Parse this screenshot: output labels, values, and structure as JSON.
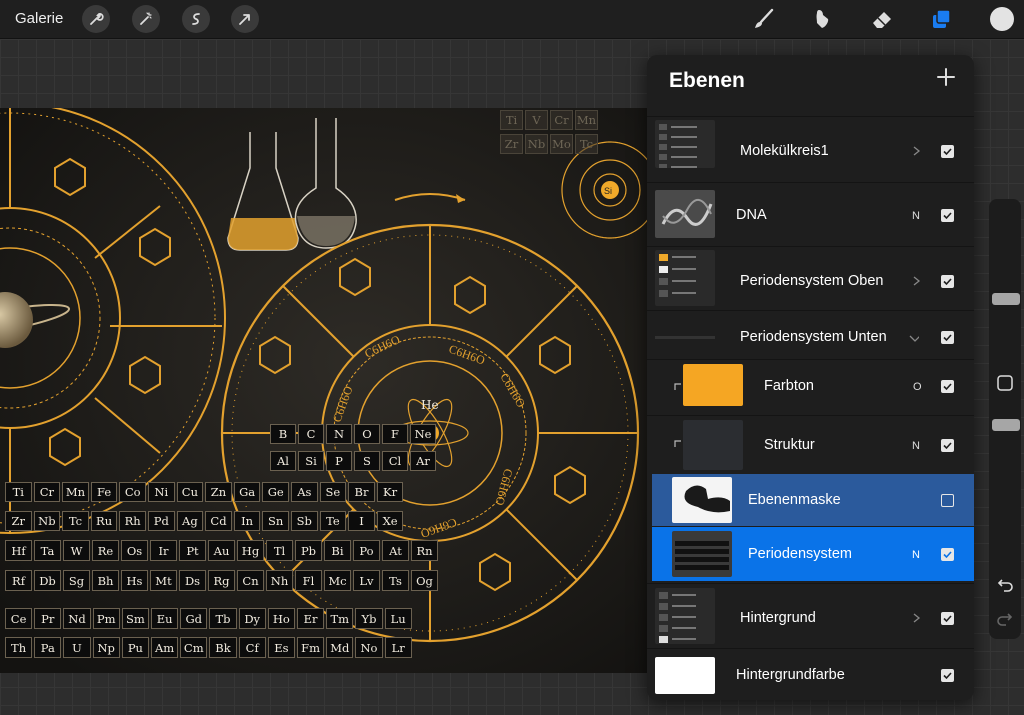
{
  "topbar": {
    "gallery_label": "Galerie",
    "left_tools": [
      "wrench-icon",
      "magic-wand-icon",
      "selection-s-icon",
      "transform-arrow-icon"
    ],
    "right_tools": [
      "brush-icon",
      "smudge-icon",
      "eraser-icon",
      "layers-icon",
      "color-circle-icon"
    ],
    "accent_color": "#1a7cf0",
    "current_color": "#e3e3e3"
  },
  "layers_panel": {
    "title": "Ebenen",
    "add_label": "+",
    "layers": [
      {
        "name": "Molekülkreis1",
        "type": "group",
        "mode": "",
        "visible": true
      },
      {
        "name": "DNA",
        "type": "layer",
        "mode": "N",
        "visible": true
      },
      {
        "name": "Periodensystem Oben",
        "type": "group",
        "mode": "",
        "visible": true
      },
      {
        "name": "Periodensystem Unten",
        "type": "group-expanded",
        "mode": "",
        "visible": true
      },
      {
        "name": "Farbton",
        "type": "clipped",
        "mode": "O",
        "visible": true
      },
      {
        "name": "Struktur",
        "type": "clipped",
        "mode": "N",
        "visible": true
      },
      {
        "name": "Ebenenmaske",
        "type": "mask",
        "mode": "",
        "visible": false
      },
      {
        "name": "Periodensystem",
        "type": "layer-selected",
        "mode": "N",
        "visible": true
      },
      {
        "name": "Hintergrund",
        "type": "group",
        "mode": "",
        "visible": true
      },
      {
        "name": "Hintergrundfarbe",
        "type": "background",
        "mode": "",
        "visible": true
      }
    ]
  },
  "canvas": {
    "periodic_rows": [
      [
        "Ti",
        "V",
        "Cr",
        "Mn"
      ],
      [
        "Zr",
        "Nb",
        "Mo",
        "Tc"
      ],
      [
        "B",
        "C",
        "N",
        "O",
        "F",
        "Ne"
      ],
      [
        "Al",
        "Si",
        "P",
        "S",
        "Cl",
        "Ar"
      ],
      [
        "Ti",
        "Cr",
        "Mn",
        "Fe",
        "Co",
        "Ni",
        "Cu",
        "Zn",
        "Ga",
        "Ge",
        "As",
        "Se",
        "Br",
        "Kr"
      ],
      [
        "Zr",
        "Nb",
        "Tc",
        "Ru",
        "Rh",
        "Pd",
        "Ag",
        "Cd",
        "In",
        "Sn",
        "Sb",
        "Te",
        "I",
        "Xe"
      ],
      [
        "Hf",
        "Ta",
        "W",
        "Re",
        "Os",
        "Ir",
        "Pt",
        "Au",
        "Hg",
        "Tl",
        "Pb",
        "Bi",
        "Po",
        "At",
        "Rn"
      ],
      [
        "Rf",
        "Db",
        "Sg",
        "Bh",
        "Hs",
        "Mt",
        "Ds",
        "Rg",
        "Cn",
        "Nh",
        "Fl",
        "Mc",
        "Lv",
        "Ts",
        "Og"
      ],
      [
        "Ce",
        "Pr",
        "Nd",
        "Pm",
        "Sm",
        "Eu",
        "Gd",
        "Tb",
        "Dy",
        "Ho",
        "Er",
        "Tm",
        "Yb",
        "Lu"
      ],
      [
        "Th",
        "Pa",
        "U",
        "Np",
        "Pu",
        "Am",
        "Cm",
        "Bk",
        "Cf",
        "Es",
        "Fm",
        "Md",
        "No",
        "Lr"
      ]
    ],
    "center_element": "He",
    "atom_label": "Si",
    "formulas": [
      "C6H6O",
      "C6H6O",
      "C6H6O",
      "C6H6O",
      "C6H6O",
      "C6H6O"
    ],
    "gold_color": "#f0a92a"
  }
}
